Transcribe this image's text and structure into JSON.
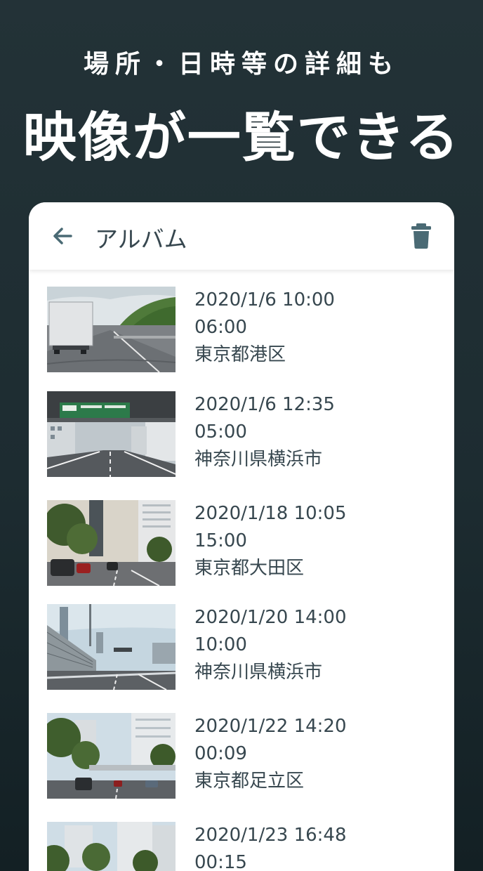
{
  "promo": {
    "subtitle": "場所・日時等の詳細も",
    "title": "映像が一覧できる"
  },
  "appbar": {
    "back_icon": "arrow-back-icon",
    "title": "アルバム",
    "trash_icon": "trash-icon"
  },
  "videos": [
    {
      "date": "2020/1/6 10:00",
      "duration": "06:00",
      "location": "東京都港区"
    },
    {
      "date": "2020/1/6 12:35",
      "duration": "05:00",
      "location": "神奈川県横浜市"
    },
    {
      "date": "2020/1/18 10:05",
      "duration": "15:00",
      "location": "東京都大田区"
    },
    {
      "date": "2020/1/20 14:00",
      "duration": "10:00",
      "location": "神奈川県横浜市"
    },
    {
      "date": "2020/1/22 14:20",
      "duration": "00:09",
      "location": "東京都足立区"
    },
    {
      "date": "2020/1/23 16:48",
      "duration": "00:15",
      "location": ""
    }
  ],
  "colors": {
    "background": "#1d2c31",
    "card": "#ffffff",
    "text": "#37474f",
    "icon": "#4a6a74"
  }
}
